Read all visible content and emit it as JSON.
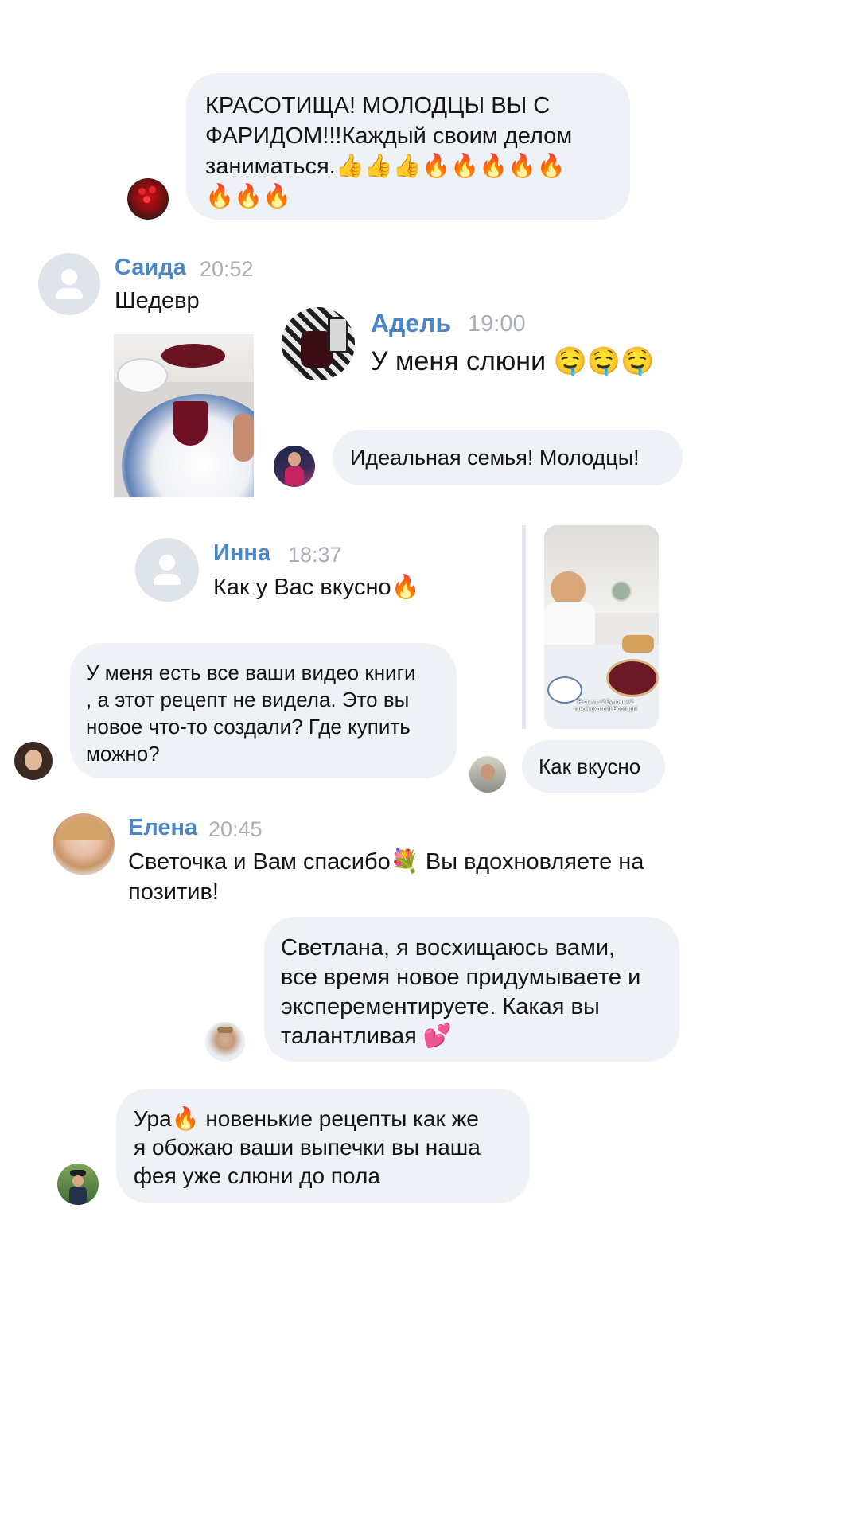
{
  "comments": [
    {
      "text": "КРАСОТИЩА! МОЛОДЦЫ ВЫ С\nФАРИДОМ!!!Каждый своим делом\nзаниматься.👍👍👍🔥🔥🔥🔥🔥\n🔥🔥🔥",
      "avatar": "user-avatar-icon"
    },
    {
      "author": "Саида",
      "time": "20:52",
      "text": "Шедевр"
    },
    {
      "author": "Адель",
      "time": "19:00",
      "text": "У меня слюни 🤤🤤🤤"
    },
    {
      "text": "Идеальная семья! Молодцы!"
    },
    {
      "author": "Инна",
      "time": "18:37",
      "text": "Как у Вас вкусно🔥"
    },
    {
      "text": "У меня есть все ваши видео книги\n, а этот рецепт не видела. Это вы\nновое что-то создали? Где купить\nможно?"
    },
    {
      "text": "Как вкусно"
    },
    {
      "author": "Елена",
      "time": "20:45",
      "text": "Светочка и Вам спасибо💐 Вы вдохновляете на\nпозитив!"
    },
    {
      "text": "Светлана, я восхищаюсь вами,\nвсе время новое придумываете и\nэксперементируете. Какая вы\nталантливая 💕"
    },
    {
      "text": "Ура🔥 новенькие рецепты как же\nя обожаю ваши выпечки вы наша\nфея уже слюни до пола"
    }
  ],
  "video_caption": "Я съела 2 булочки 2\nтакой охотой! Восторг!",
  "colors": {
    "bubble": "#eef1f5",
    "name": "#4a86c8",
    "time": "#a9adb4",
    "placeholder": "#dfe3ea"
  }
}
